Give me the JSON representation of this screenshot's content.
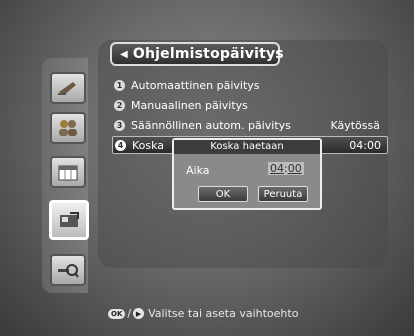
{
  "header": {
    "title": "Ohjelmistopäivitys",
    "back_icon": "triangle-left-icon"
  },
  "menu": [
    {
      "num": "1",
      "label": "Automaattinen päivitys",
      "value": ""
    },
    {
      "num": "2",
      "label": "Manuaalinen päivitys",
      "value": ""
    },
    {
      "num": "3",
      "label": "Säännöllinen autom. päivitys",
      "value": "Käytössä"
    },
    {
      "num": "4",
      "label": "Koska",
      "value": "04:00"
    }
  ],
  "dialog": {
    "title": "Koska haetaan",
    "field_label": "Aika",
    "hour": "04",
    "sep": ":",
    "minute": "00",
    "ok_label": "OK",
    "cancel_label": "Peruuta"
  },
  "footer": {
    "ok_key": "OK",
    "slash": "/",
    "arrow_key": "▶",
    "text": "Valitse tai aseta vaihtoehto"
  },
  "sidebar": {
    "items": [
      {
        "name": "satellite-dish-icon"
      },
      {
        "name": "users-icon"
      },
      {
        "name": "calendar-icon"
      },
      {
        "name": "receiver-icon",
        "active": true
      },
      {
        "name": "key-search-icon"
      }
    ]
  }
}
